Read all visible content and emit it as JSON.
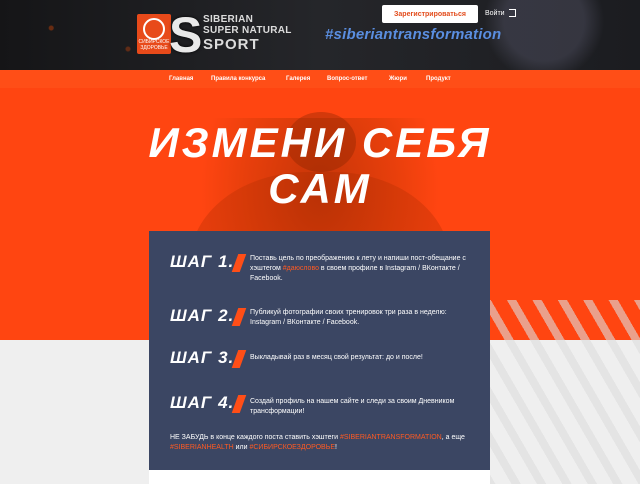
{
  "header": {
    "logo_caption": "СИБИРСКОЕ ЗДОРОВЬЕ",
    "logo_letter": "S",
    "logo_line1": "SIBERIAN",
    "logo_line2": "SUPER NATURAL",
    "logo_line3": "SPORT",
    "register_label": "Зарегистрироваться",
    "login_label": "Войти",
    "hashtag": "#siberiantransformation"
  },
  "nav": {
    "items": [
      "Главная",
      "Правила конкурса",
      "Галерея",
      "Вопрос-ответ",
      "Жюри",
      "Продукт"
    ]
  },
  "hero": {
    "title_line1": "ИЗМЕНИ СЕБЯ",
    "title_line2": "САМ"
  },
  "steps": [
    {
      "title": "ШАГ 1.",
      "text_before": "Поставь цель по преображению к лету и напиши пост-обещание с хэштегом ",
      "text_highlight": "#даюслово",
      "text_after": " в своем профиле в Instagram / ВКонтакте / Facebook."
    },
    {
      "title": "ШАГ 2.",
      "text": "Публикуй фотографии своих тренировок три раза в неделю: Instagram / ВКонтакте / Facebook."
    },
    {
      "title": "ШАГ 3.",
      "text": "Выкладывай раз в месяц свой результат: до и после!"
    },
    {
      "title": "ШАГ 4.",
      "text": "Создай профиль на нашем сайте и следи за своим Дневником трансформации!"
    }
  ],
  "reminder": {
    "part1": "НЕ ЗАБУДЬ в конце каждого поста ставить хэштеги ",
    "tag1": "#SIBERIANTRANSFORMATION",
    "part2": ", а еще ",
    "tag2": "#SIBERIANHEALTH",
    "part3": " или ",
    "tag3": "#СИБИРСКОЕЗДОРОВЬЕ",
    "part4": "!"
  },
  "colors": {
    "accent": "#ff4e17",
    "panel": "#3b4663",
    "hashtag": "#5a8ee0"
  }
}
